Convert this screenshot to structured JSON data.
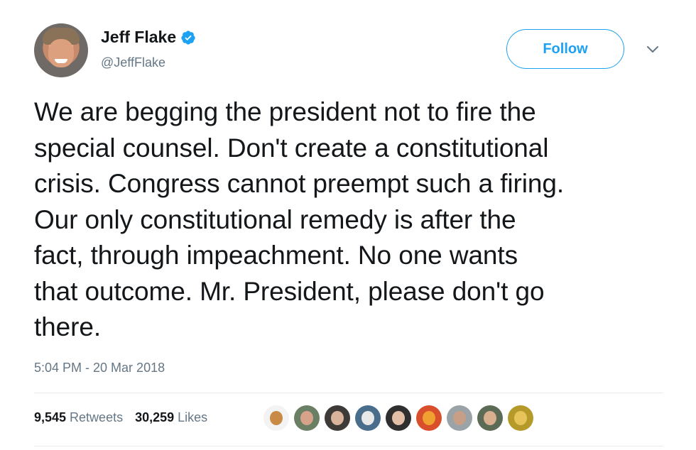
{
  "author": {
    "display_name": "Jeff Flake",
    "handle": "@JeffFlake",
    "verified": true
  },
  "follow_label": "Follow",
  "tweet_lines": [
    "We are begging the president not to fire the",
    "special counsel. Don't create a constitutional",
    "crisis. Congress cannot preempt such a firing.",
    "Our only constitutional remedy is after the",
    "fact, through impeachment. No one wants",
    "that outcome. Mr. President, please don't go",
    "there."
  ],
  "timestamp": "5:04 PM - 20 Mar 2018",
  "stats": {
    "retweets_count": "9,545",
    "retweets_label": "Retweets",
    "likes_count": "30,259",
    "likes_label": "Likes"
  },
  "icons": {
    "verified": "verified-badge-icon",
    "menu": "chevron-down-icon"
  },
  "colors": {
    "accent": "#1da1f2",
    "secondary_text": "#657786",
    "primary_text": "#14171a"
  }
}
